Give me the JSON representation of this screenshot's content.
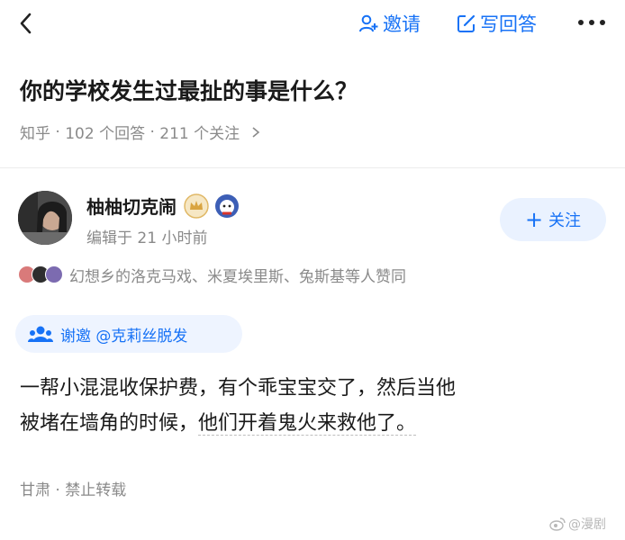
{
  "topbar": {
    "invite_label": "邀请",
    "write_label": "写回答",
    "icons": {
      "back": "chevron-left-icon",
      "invite": "add-person-icon",
      "write": "edit-icon",
      "more": "more-dots-icon"
    }
  },
  "question": {
    "title": "你的学校发生过最扯的事是什么？",
    "source": "知乎",
    "answers": "102 个回答",
    "followers": "211 个关注"
  },
  "answer": {
    "author": "柚柚切克闹",
    "edited": "编辑于 21 小时前",
    "follow_label": "关注",
    "likes_text": "幻想乡的洛克马戏、米夏埃里斯、兔斯基等人赞同",
    "thanks_label": "谢邀 @克莉丝脱发",
    "content_line1": "一帮小混混收保护费，有个乖宝宝交了，然后当他",
    "content_line2_a": "被堵在墙角的时候，",
    "content_line2_b": "他们开着鬼火来救他了。",
    "location": "甘肃",
    "copyright": "禁止转载"
  },
  "watermark": "@漫剧",
  "colors": {
    "accent": "#1772f6",
    "muted": "#8a8a8a",
    "follow_bg": "#eaf2ff"
  }
}
